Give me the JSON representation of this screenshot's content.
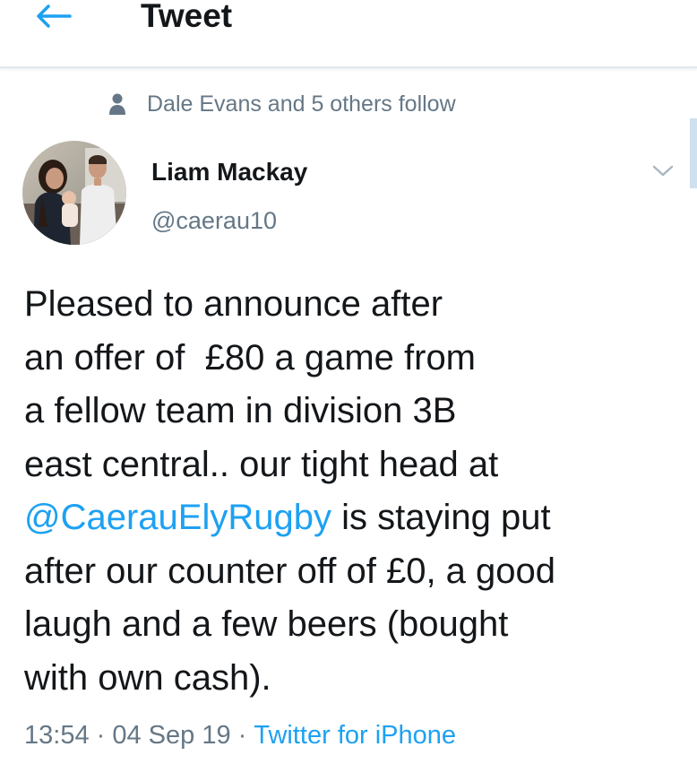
{
  "header": {
    "title": "Tweet",
    "back_icon": "arrow-left-icon"
  },
  "social_context": {
    "icon": "person-icon",
    "text": "Dale Evans and 5 others follow"
  },
  "tweet": {
    "author_name": "Liam Mackay",
    "author_handle": "@caerau10",
    "text_part1": "Pleased to announce after\nan offer of  £80 a game from\na fellow team in division 3B\neast central.. our tight head at\n",
    "mention": "@CaerauElyRugby",
    "text_part2": " is staying put\nafter our counter off of £0, a good\nlaugh and a few beers (bought\nwith own cash).",
    "time": "13:54",
    "separator": " · ",
    "date": "04 Sep 19",
    "source": "Twitter for iPhone"
  },
  "colors": {
    "accent": "#1da1f2",
    "secondary_text": "#657786",
    "primary_text": "#14171a",
    "divider": "#e1e8ed"
  }
}
